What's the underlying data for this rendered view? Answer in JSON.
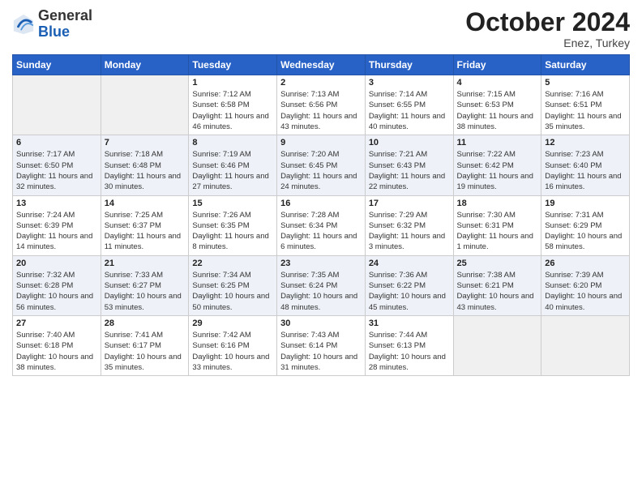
{
  "logo": {
    "general": "General",
    "blue": "Blue"
  },
  "title": "October 2024",
  "subtitle": "Enez, Turkey",
  "headers": [
    "Sunday",
    "Monday",
    "Tuesday",
    "Wednesday",
    "Thursday",
    "Friday",
    "Saturday"
  ],
  "weeks": [
    [
      {
        "day": "",
        "info": ""
      },
      {
        "day": "",
        "info": ""
      },
      {
        "day": "1",
        "info": "Sunrise: 7:12 AM\nSunset: 6:58 PM\nDaylight: 11 hours and 46 minutes."
      },
      {
        "day": "2",
        "info": "Sunrise: 7:13 AM\nSunset: 6:56 PM\nDaylight: 11 hours and 43 minutes."
      },
      {
        "day": "3",
        "info": "Sunrise: 7:14 AM\nSunset: 6:55 PM\nDaylight: 11 hours and 40 minutes."
      },
      {
        "day": "4",
        "info": "Sunrise: 7:15 AM\nSunset: 6:53 PM\nDaylight: 11 hours and 38 minutes."
      },
      {
        "day": "5",
        "info": "Sunrise: 7:16 AM\nSunset: 6:51 PM\nDaylight: 11 hours and 35 minutes."
      }
    ],
    [
      {
        "day": "6",
        "info": "Sunrise: 7:17 AM\nSunset: 6:50 PM\nDaylight: 11 hours and 32 minutes."
      },
      {
        "day": "7",
        "info": "Sunrise: 7:18 AM\nSunset: 6:48 PM\nDaylight: 11 hours and 30 minutes."
      },
      {
        "day": "8",
        "info": "Sunrise: 7:19 AM\nSunset: 6:46 PM\nDaylight: 11 hours and 27 minutes."
      },
      {
        "day": "9",
        "info": "Sunrise: 7:20 AM\nSunset: 6:45 PM\nDaylight: 11 hours and 24 minutes."
      },
      {
        "day": "10",
        "info": "Sunrise: 7:21 AM\nSunset: 6:43 PM\nDaylight: 11 hours and 22 minutes."
      },
      {
        "day": "11",
        "info": "Sunrise: 7:22 AM\nSunset: 6:42 PM\nDaylight: 11 hours and 19 minutes."
      },
      {
        "day": "12",
        "info": "Sunrise: 7:23 AM\nSunset: 6:40 PM\nDaylight: 11 hours and 16 minutes."
      }
    ],
    [
      {
        "day": "13",
        "info": "Sunrise: 7:24 AM\nSunset: 6:39 PM\nDaylight: 11 hours and 14 minutes."
      },
      {
        "day": "14",
        "info": "Sunrise: 7:25 AM\nSunset: 6:37 PM\nDaylight: 11 hours and 11 minutes."
      },
      {
        "day": "15",
        "info": "Sunrise: 7:26 AM\nSunset: 6:35 PM\nDaylight: 11 hours and 8 minutes."
      },
      {
        "day": "16",
        "info": "Sunrise: 7:28 AM\nSunset: 6:34 PM\nDaylight: 11 hours and 6 minutes."
      },
      {
        "day": "17",
        "info": "Sunrise: 7:29 AM\nSunset: 6:32 PM\nDaylight: 11 hours and 3 minutes."
      },
      {
        "day": "18",
        "info": "Sunrise: 7:30 AM\nSunset: 6:31 PM\nDaylight: 11 hours and 1 minute."
      },
      {
        "day": "19",
        "info": "Sunrise: 7:31 AM\nSunset: 6:29 PM\nDaylight: 10 hours and 58 minutes."
      }
    ],
    [
      {
        "day": "20",
        "info": "Sunrise: 7:32 AM\nSunset: 6:28 PM\nDaylight: 10 hours and 56 minutes."
      },
      {
        "day": "21",
        "info": "Sunrise: 7:33 AM\nSunset: 6:27 PM\nDaylight: 10 hours and 53 minutes."
      },
      {
        "day": "22",
        "info": "Sunrise: 7:34 AM\nSunset: 6:25 PM\nDaylight: 10 hours and 50 minutes."
      },
      {
        "day": "23",
        "info": "Sunrise: 7:35 AM\nSunset: 6:24 PM\nDaylight: 10 hours and 48 minutes."
      },
      {
        "day": "24",
        "info": "Sunrise: 7:36 AM\nSunset: 6:22 PM\nDaylight: 10 hours and 45 minutes."
      },
      {
        "day": "25",
        "info": "Sunrise: 7:38 AM\nSunset: 6:21 PM\nDaylight: 10 hours and 43 minutes."
      },
      {
        "day": "26",
        "info": "Sunrise: 7:39 AM\nSunset: 6:20 PM\nDaylight: 10 hours and 40 minutes."
      }
    ],
    [
      {
        "day": "27",
        "info": "Sunrise: 7:40 AM\nSunset: 6:18 PM\nDaylight: 10 hours and 38 minutes."
      },
      {
        "day": "28",
        "info": "Sunrise: 7:41 AM\nSunset: 6:17 PM\nDaylight: 10 hours and 35 minutes."
      },
      {
        "day": "29",
        "info": "Sunrise: 7:42 AM\nSunset: 6:16 PM\nDaylight: 10 hours and 33 minutes."
      },
      {
        "day": "30",
        "info": "Sunrise: 7:43 AM\nSunset: 6:14 PM\nDaylight: 10 hours and 31 minutes."
      },
      {
        "day": "31",
        "info": "Sunrise: 7:44 AM\nSunset: 6:13 PM\nDaylight: 10 hours and 28 minutes."
      },
      {
        "day": "",
        "info": ""
      },
      {
        "day": "",
        "info": ""
      }
    ]
  ]
}
